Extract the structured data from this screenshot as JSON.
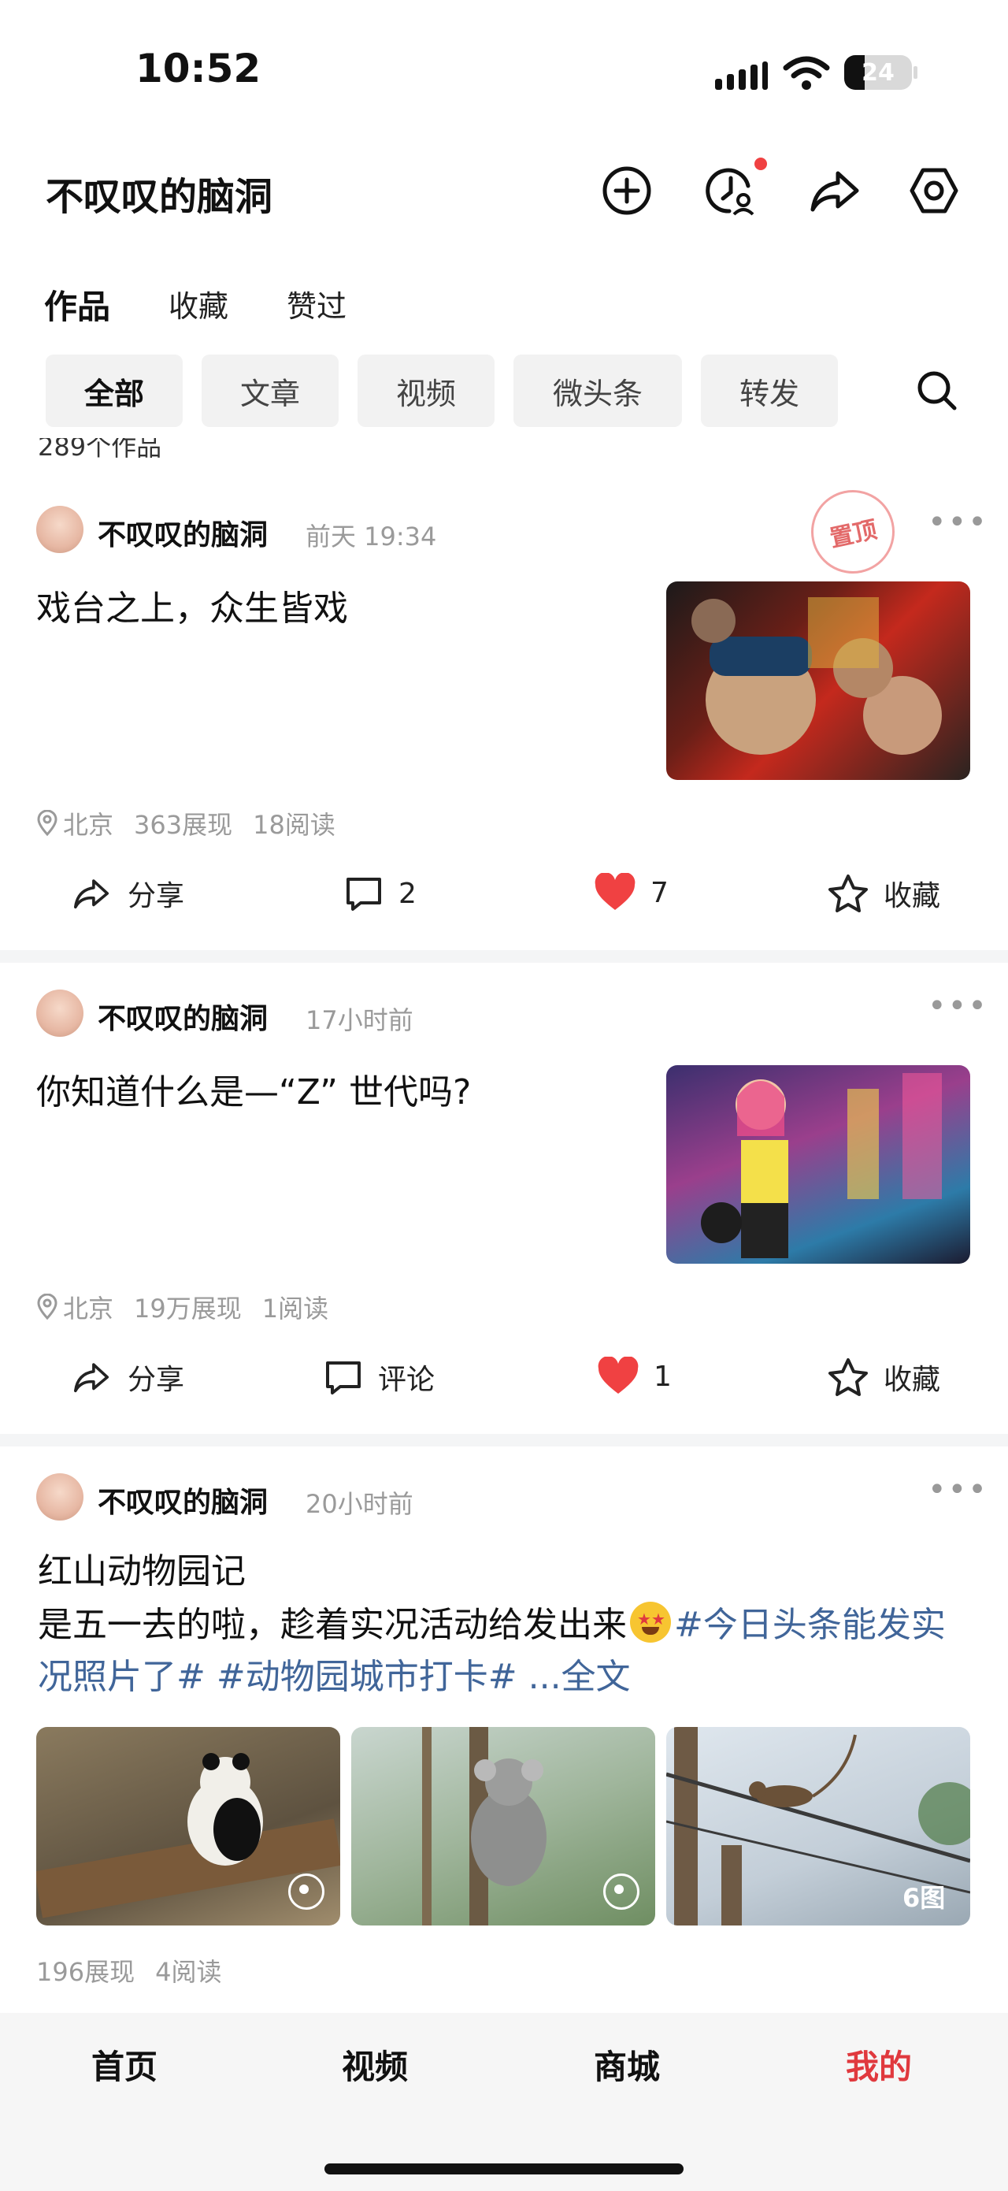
{
  "status": {
    "time": "10:52",
    "battery": "24"
  },
  "header": {
    "title": "不叹叹的脑洞"
  },
  "tabs": [
    "作品",
    "收藏",
    "赞过"
  ],
  "chips": [
    "全部",
    "文章",
    "视频",
    "微头条",
    "转发"
  ],
  "works_count": "289个作品",
  "posts": [
    {
      "author": "不叹叹的脑洞",
      "time": "前天 19:34",
      "pinned": "置顶",
      "text": "戏台之上，众生皆戏",
      "location": "北京",
      "views": "363展现",
      "reads": "18阅读",
      "share": "分享",
      "comments": "2",
      "likes": "7",
      "favorite": "收藏"
    },
    {
      "author": "不叹叹的脑洞",
      "time": "17小时前",
      "text": "你知道什么是—“Z” 世代吗?",
      "location": "北京",
      "views": "19万展现",
      "reads": "1阅读",
      "share": "分享",
      "comments": "评论",
      "likes": "1",
      "favorite": "收藏"
    },
    {
      "author": "不叹叹的脑洞",
      "time": "20小时前",
      "title": "红山动物园记",
      "body": "是五一去的啦，趁着实况活动给发出来",
      "tags": "#今日头条能发实况照片了# #动物园城市打卡#",
      "more": "...全文",
      "image_count": "6图",
      "views": "196展现",
      "reads": "4阅读"
    }
  ],
  "nav": [
    "首页",
    "视频",
    "商城",
    "我的"
  ],
  "colors": {
    "accent": "#f04142",
    "like": "#f04142",
    "tag": "#406599",
    "nav_active": "#e0393e"
  }
}
